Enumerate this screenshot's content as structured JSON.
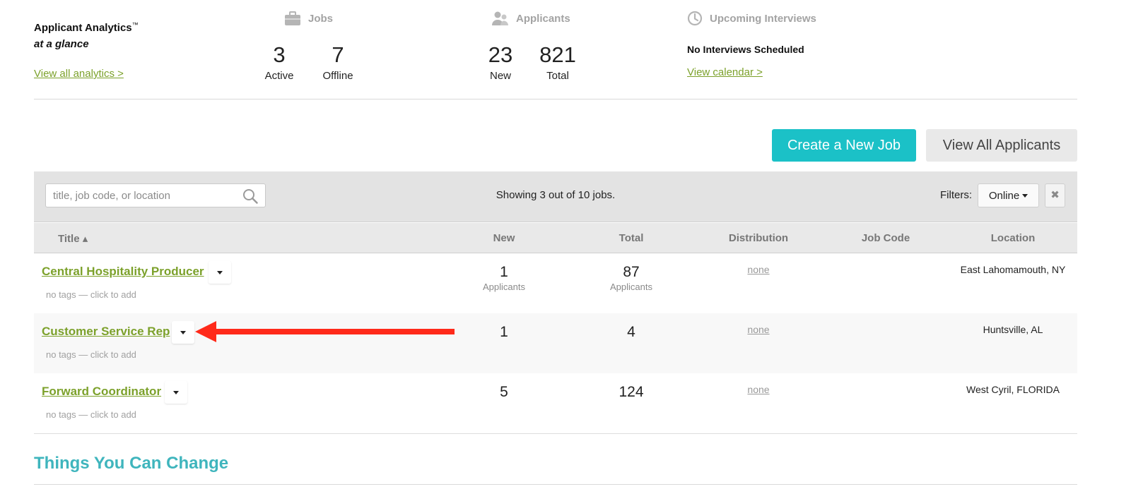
{
  "analytics": {
    "title": "Applicant Analytics",
    "title_mark": "™",
    "subtitle": "at a glance",
    "view_all_link": "View all analytics >",
    "jobs": {
      "label": "Jobs",
      "icon": "briefcase-icon",
      "active_value": "3",
      "active_label": "Active",
      "offline_value": "7",
      "offline_label": "Offline"
    },
    "applicants": {
      "label": "Applicants",
      "icon": "people-icon",
      "new_value": "23",
      "new_label": "New",
      "total_value": "821",
      "total_label": "Total"
    },
    "interviews": {
      "label": "Upcoming Interviews",
      "icon": "clock-icon",
      "status": "No Interviews Scheduled",
      "calendar_link": "View calendar >"
    }
  },
  "actions": {
    "create_job": "Create a New Job",
    "view_all_applicants": "View All Applicants"
  },
  "filterbar": {
    "search_placeholder": "title, job code, or location",
    "search_value": "",
    "showing_text": "Showing 3 out of 10 jobs.",
    "filters_label": "Filters:",
    "filter_value": "Online",
    "clear_icon": "close-icon"
  },
  "table": {
    "columns": {
      "title": "Title ▴",
      "new": "New",
      "total": "Total",
      "distribution": "Distribution",
      "job_code": "Job Code",
      "location": "Location"
    },
    "rows": [
      {
        "title": "Central Hospitality Producer",
        "tags": "no tags — click to add",
        "new": "1",
        "new_sub": "Applicants",
        "total": "87",
        "total_sub": "Applicants",
        "distribution": "none",
        "job_code": "",
        "location": "East Lahomamouth, NY"
      },
      {
        "title": "Customer Service Rep",
        "tags": "no tags — click to add",
        "new": "1",
        "new_sub": "",
        "total": "4",
        "total_sub": "",
        "distribution": "none",
        "job_code": "",
        "location": "Huntsville, AL"
      },
      {
        "title": "Forward Coordinator",
        "tags": "no tags — click to add",
        "new": "5",
        "new_sub": "",
        "total": "124",
        "total_sub": "",
        "distribution": "none",
        "job_code": "",
        "location": "West Cyril, FLORIDA"
      }
    ]
  },
  "section": {
    "title": "Things You Can Change"
  },
  "colors": {
    "link_green": "#7ca12b",
    "accent_teal": "#1bc1c7",
    "section_teal": "#3fb5bd",
    "annotation_red": "#ff2a1a"
  }
}
